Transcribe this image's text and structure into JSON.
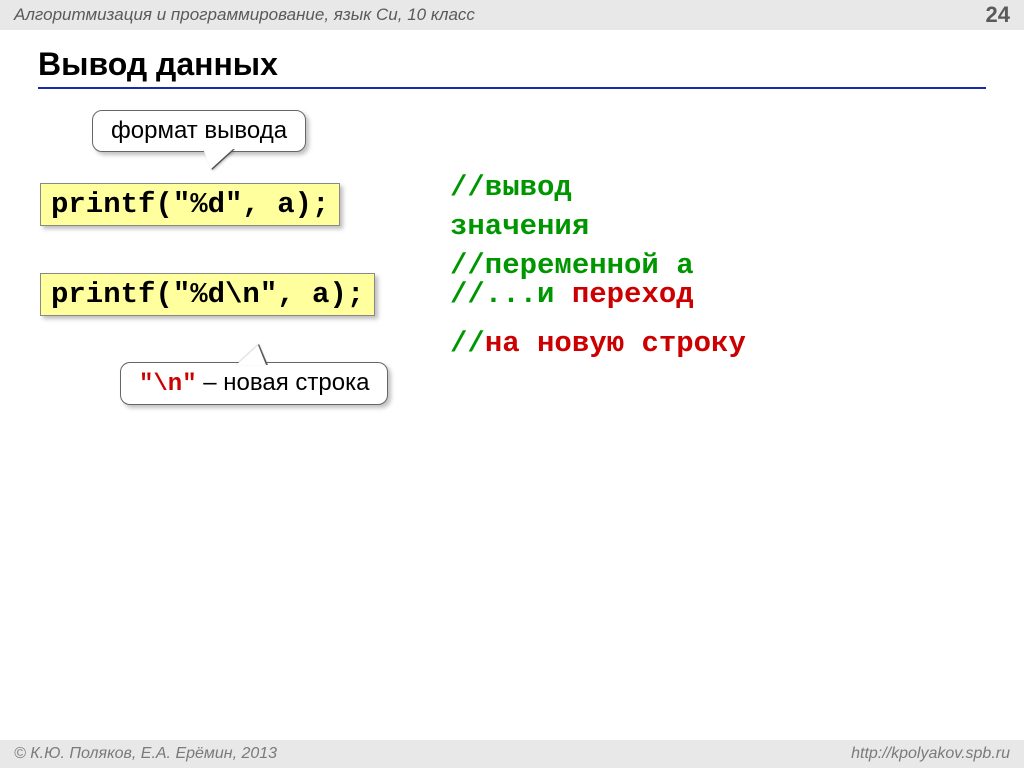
{
  "header": {
    "subject": "Алгоритмизация и программирование, язык Си, 10 класс",
    "page_number": "24"
  },
  "title": "Вывод данных",
  "callout_format": "формат вывода",
  "code1": "printf(\"%d\", a);",
  "code2": "printf(\"%d\\n\", a);",
  "comment1": {
    "line1": "//вывод",
    "line2": "значения",
    "line3": "//переменной a"
  },
  "comment2": {
    "prefix": "//...и ",
    "word1": "переход",
    "prefix2": "//",
    "rest2": "на новую строку"
  },
  "callout_newline": {
    "code": "\"\\n\"",
    "text": " – новая строка"
  },
  "footer": {
    "copyright": "© К.Ю. Поляков, Е.А. Ерёмин, 2013",
    "url": "http://kpolyakov.spb.ru"
  }
}
